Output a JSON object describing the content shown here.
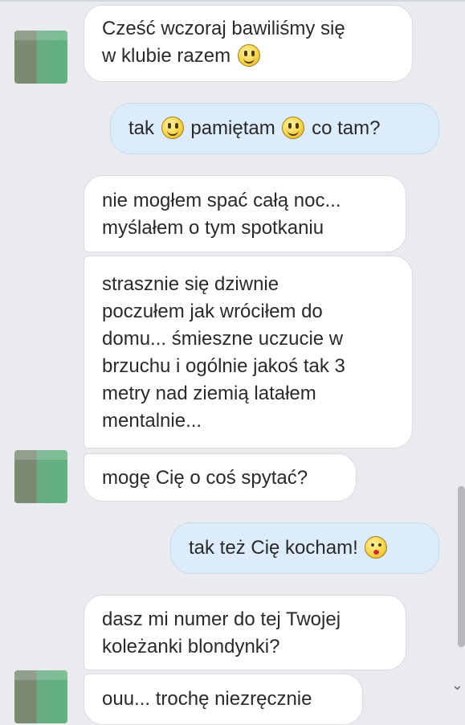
{
  "messages": [
    {
      "from": "contact",
      "text1": "Cześć wczoraj bawiliśmy się",
      "text2": "w klubie razem"
    },
    {
      "from": "me",
      "t1": "tak",
      "t2": "pamiętam",
      "t3": "co tam?"
    },
    {
      "from": "contact",
      "text1": "nie mogłem spać całą noc...",
      "text2": "myślałem o tym spotkaniu"
    },
    {
      "from": "contact",
      "lines": [
        "strasznie się dziwnie",
        "poczułem jak wróciłem do",
        "domu... śmieszne uczucie w",
        "brzuchu i ogólnie jakoś tak 3",
        "metry nad ziemią latałem",
        "mentalnie..."
      ]
    },
    {
      "from": "contact",
      "text": "mogę Cię o coś spytać?"
    },
    {
      "from": "me",
      "text": "tak też Cię kocham!"
    },
    {
      "from": "contact",
      "text1": "dasz mi numer do tej Twojej",
      "text2": "koleżanki blondynki?"
    },
    {
      "from": "contact",
      "text": "ouu... trochę niezręcznie"
    }
  ],
  "icons": {
    "smile": "smile-emoji",
    "kiss": "kiss-emoji",
    "scroll": "scroll-down-arrow"
  },
  "colors": {
    "background": "#e9ebee",
    "incoming_bubble": "#ffffff",
    "outgoing_bubble": "#dcecfb"
  }
}
